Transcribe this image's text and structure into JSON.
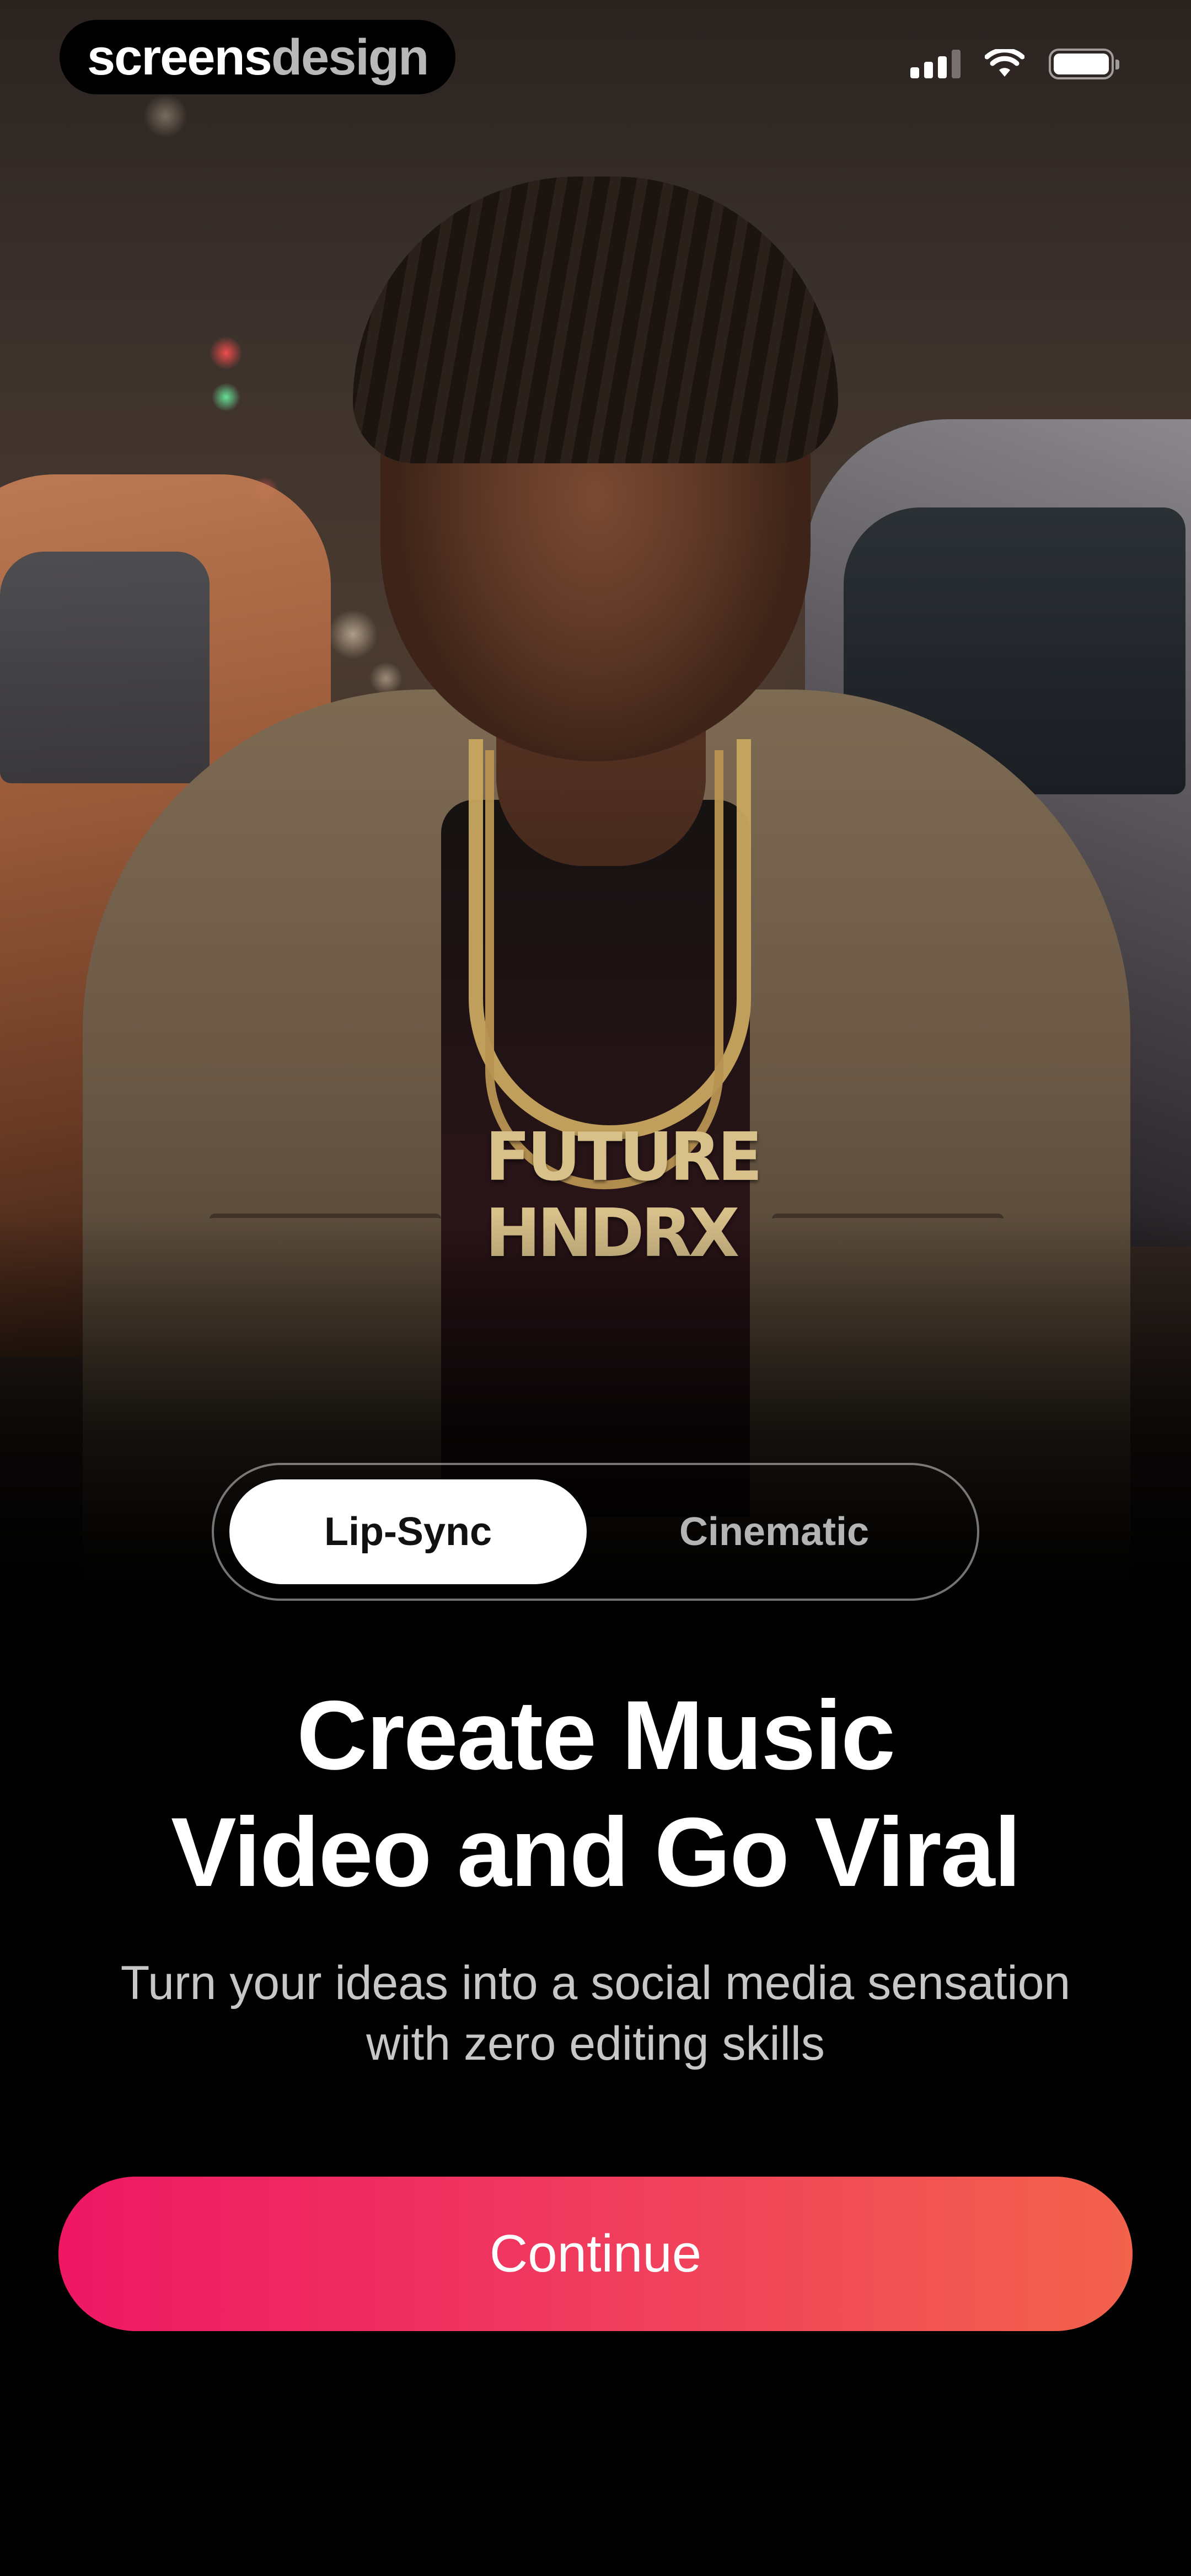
{
  "brand": {
    "part1": "screens",
    "part2": "design"
  },
  "status_bar": {
    "signal_icon": "cellular-signal-icon",
    "wifi_icon": "wifi-icon",
    "battery_icon": "battery-icon",
    "battery_level": 1.0
  },
  "hero": {
    "pendant_line1": "FUTURE",
    "pendant_line2": "HNDRX"
  },
  "mode_toggle": {
    "options": [
      {
        "label": "Lip-Sync",
        "selected": true
      },
      {
        "label": "Cinematic",
        "selected": false
      }
    ]
  },
  "headline": {
    "line1": "Create Music",
    "line2": "Video and Go Viral"
  },
  "subtitle": {
    "line1": "Turn your ideas into a social media sensation",
    "line2": "with zero editing skills"
  },
  "cta": {
    "label": "Continue"
  },
  "colors": {
    "background": "#000000",
    "cta_gradient_start": "#EE1764",
    "cta_gradient_end": "#F2624C",
    "toggle_active_bg": "#FFFFFF",
    "toggle_active_text": "#111111"
  }
}
